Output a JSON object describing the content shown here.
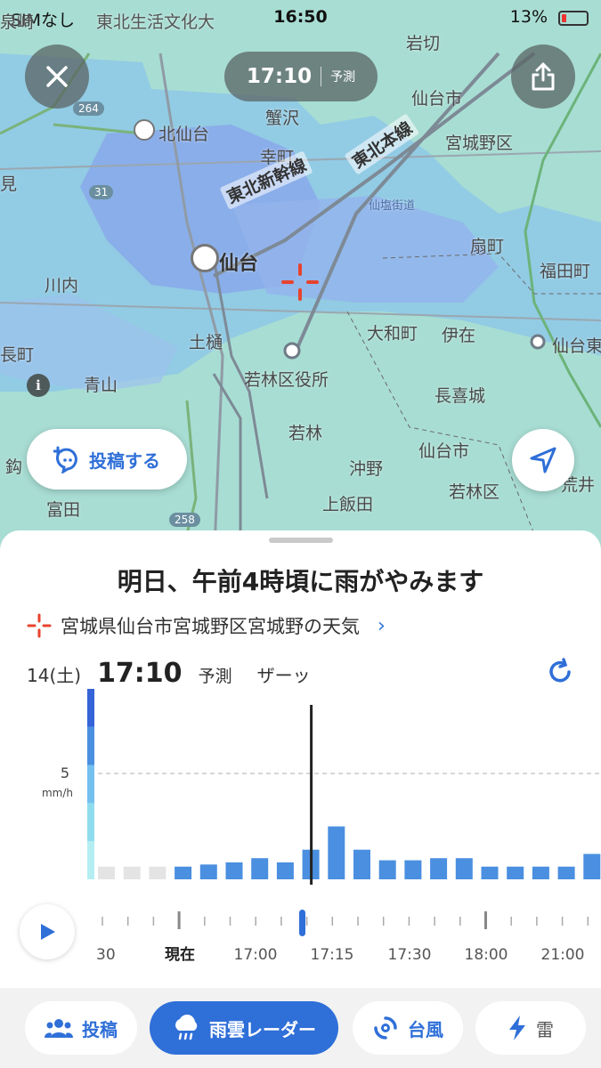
{
  "status_bar": {
    "carrier": "SIMなし",
    "time": "16:50",
    "battery": "13%"
  },
  "map": {
    "time_pill": {
      "time": "17:10",
      "label": "予測"
    },
    "places": [
      {
        "id": "p1",
        "text": "東北生活文化大"
      },
      {
        "id": "p2",
        "text": "岩切"
      },
      {
        "id": "p3",
        "text": "仙台市"
      },
      {
        "id": "p4",
        "text": "北仙台"
      },
      {
        "id": "p5",
        "text": "蟹沢"
      },
      {
        "id": "p6",
        "text": "宮城野区"
      },
      {
        "id": "p7",
        "text": "幸町"
      },
      {
        "id": "p8",
        "text": "見"
      },
      {
        "id": "p9",
        "text": "仙塩街道"
      },
      {
        "id": "p10",
        "text": "扇町"
      },
      {
        "id": "p11",
        "text": "仙台"
      },
      {
        "id": "p12",
        "text": "福田町"
      },
      {
        "id": "p13",
        "text": "川内"
      },
      {
        "id": "p14",
        "text": "大和町"
      },
      {
        "id": "p15",
        "text": "伊在"
      },
      {
        "id": "p16",
        "text": "土樋"
      },
      {
        "id": "p17",
        "text": "仙台東"
      },
      {
        "id": "p18",
        "text": "長町"
      },
      {
        "id": "p19",
        "text": "若林区役所"
      },
      {
        "id": "p20",
        "text": "青山"
      },
      {
        "id": "p21",
        "text": "長喜城"
      },
      {
        "id": "p22",
        "text": "若林"
      },
      {
        "id": "p23",
        "text": "仙台市"
      },
      {
        "id": "p24",
        "text": "鈎"
      },
      {
        "id": "p25",
        "text": "沖野"
      },
      {
        "id": "p26",
        "text": "若林区"
      },
      {
        "id": "p27",
        "text": "荒井"
      },
      {
        "id": "p28",
        "text": "上飯田"
      },
      {
        "id": "p29",
        "text": "富田"
      },
      {
        "id": "p30",
        "text": "泉崎"
      }
    ],
    "rail_labels": {
      "shinkansen": "東北新幹線",
      "honsen": "東北本線"
    },
    "route_badges": [
      "264",
      "31",
      "258"
    ],
    "post_button": "投稿する"
  },
  "sheet": {
    "headline": "明日、午前4時頃に雨がやみます",
    "location": "宮城県仙台市宮城野区宮城野の天気",
    "date": "14(土)",
    "time": "17:10",
    "forecast_label": "予測",
    "description": "ザーッ"
  },
  "chart_data": {
    "type": "bar",
    "title": "",
    "ylabel": "mm/h",
    "yticks": [
      "5"
    ],
    "ylim": [
      0,
      9
    ],
    "selected_index": 8,
    "values": [
      0.6,
      0.6,
      0.6,
      0.6,
      0.7,
      0.8,
      1.0,
      0.8,
      1.4,
      2.5,
      1.4,
      0.9,
      0.9,
      1.0,
      1.0,
      0.6,
      0.6,
      0.6,
      0.6,
      1.2,
      0.6
    ],
    "past_count": 3,
    "timeline_labels": [
      "30",
      "現在",
      "17:00",
      "17:15",
      "17:30",
      "18:00",
      "21:00"
    ]
  },
  "tabs": [
    {
      "id": "post",
      "label": "投稿",
      "icon": "people-icon"
    },
    {
      "id": "radar",
      "label": "雨雲レーダー",
      "icon": "rain-cloud-icon",
      "active": true
    },
    {
      "id": "typhoon",
      "label": "台風",
      "icon": "typhoon-icon"
    },
    {
      "id": "thunder",
      "label": "雷",
      "icon": "lightning-icon"
    }
  ],
  "colors": {
    "accent": "#2f6fd8",
    "rain_light": "#8fc4f2",
    "rain_bar": "#4a8fe0",
    "past_bar": "#e4e4e4"
  }
}
